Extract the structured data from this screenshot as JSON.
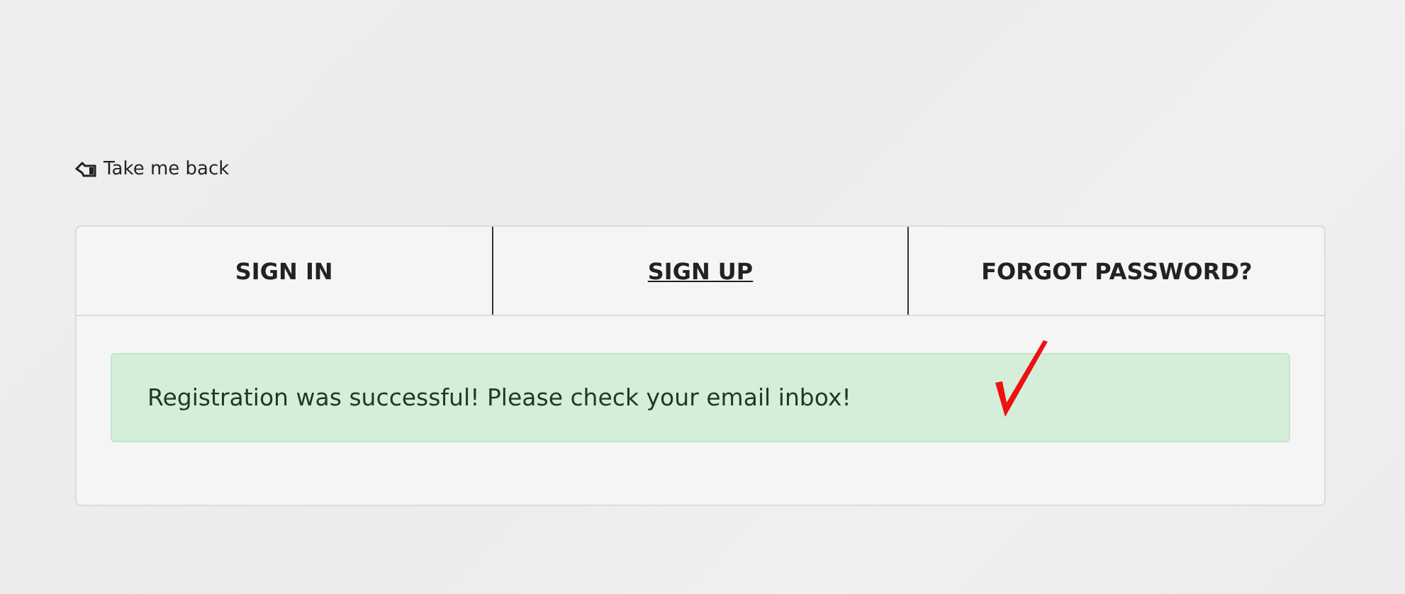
{
  "back_link": {
    "label": "Take me back"
  },
  "tabs": [
    {
      "label": "SIGN IN",
      "selected": false
    },
    {
      "label": "SIGN UP",
      "selected": true
    },
    {
      "label": "FORGOT PASSWORD?",
      "selected": false
    }
  ],
  "alert": {
    "kind": "success",
    "message": "Registration was successful! Please check your email inbox!"
  }
}
